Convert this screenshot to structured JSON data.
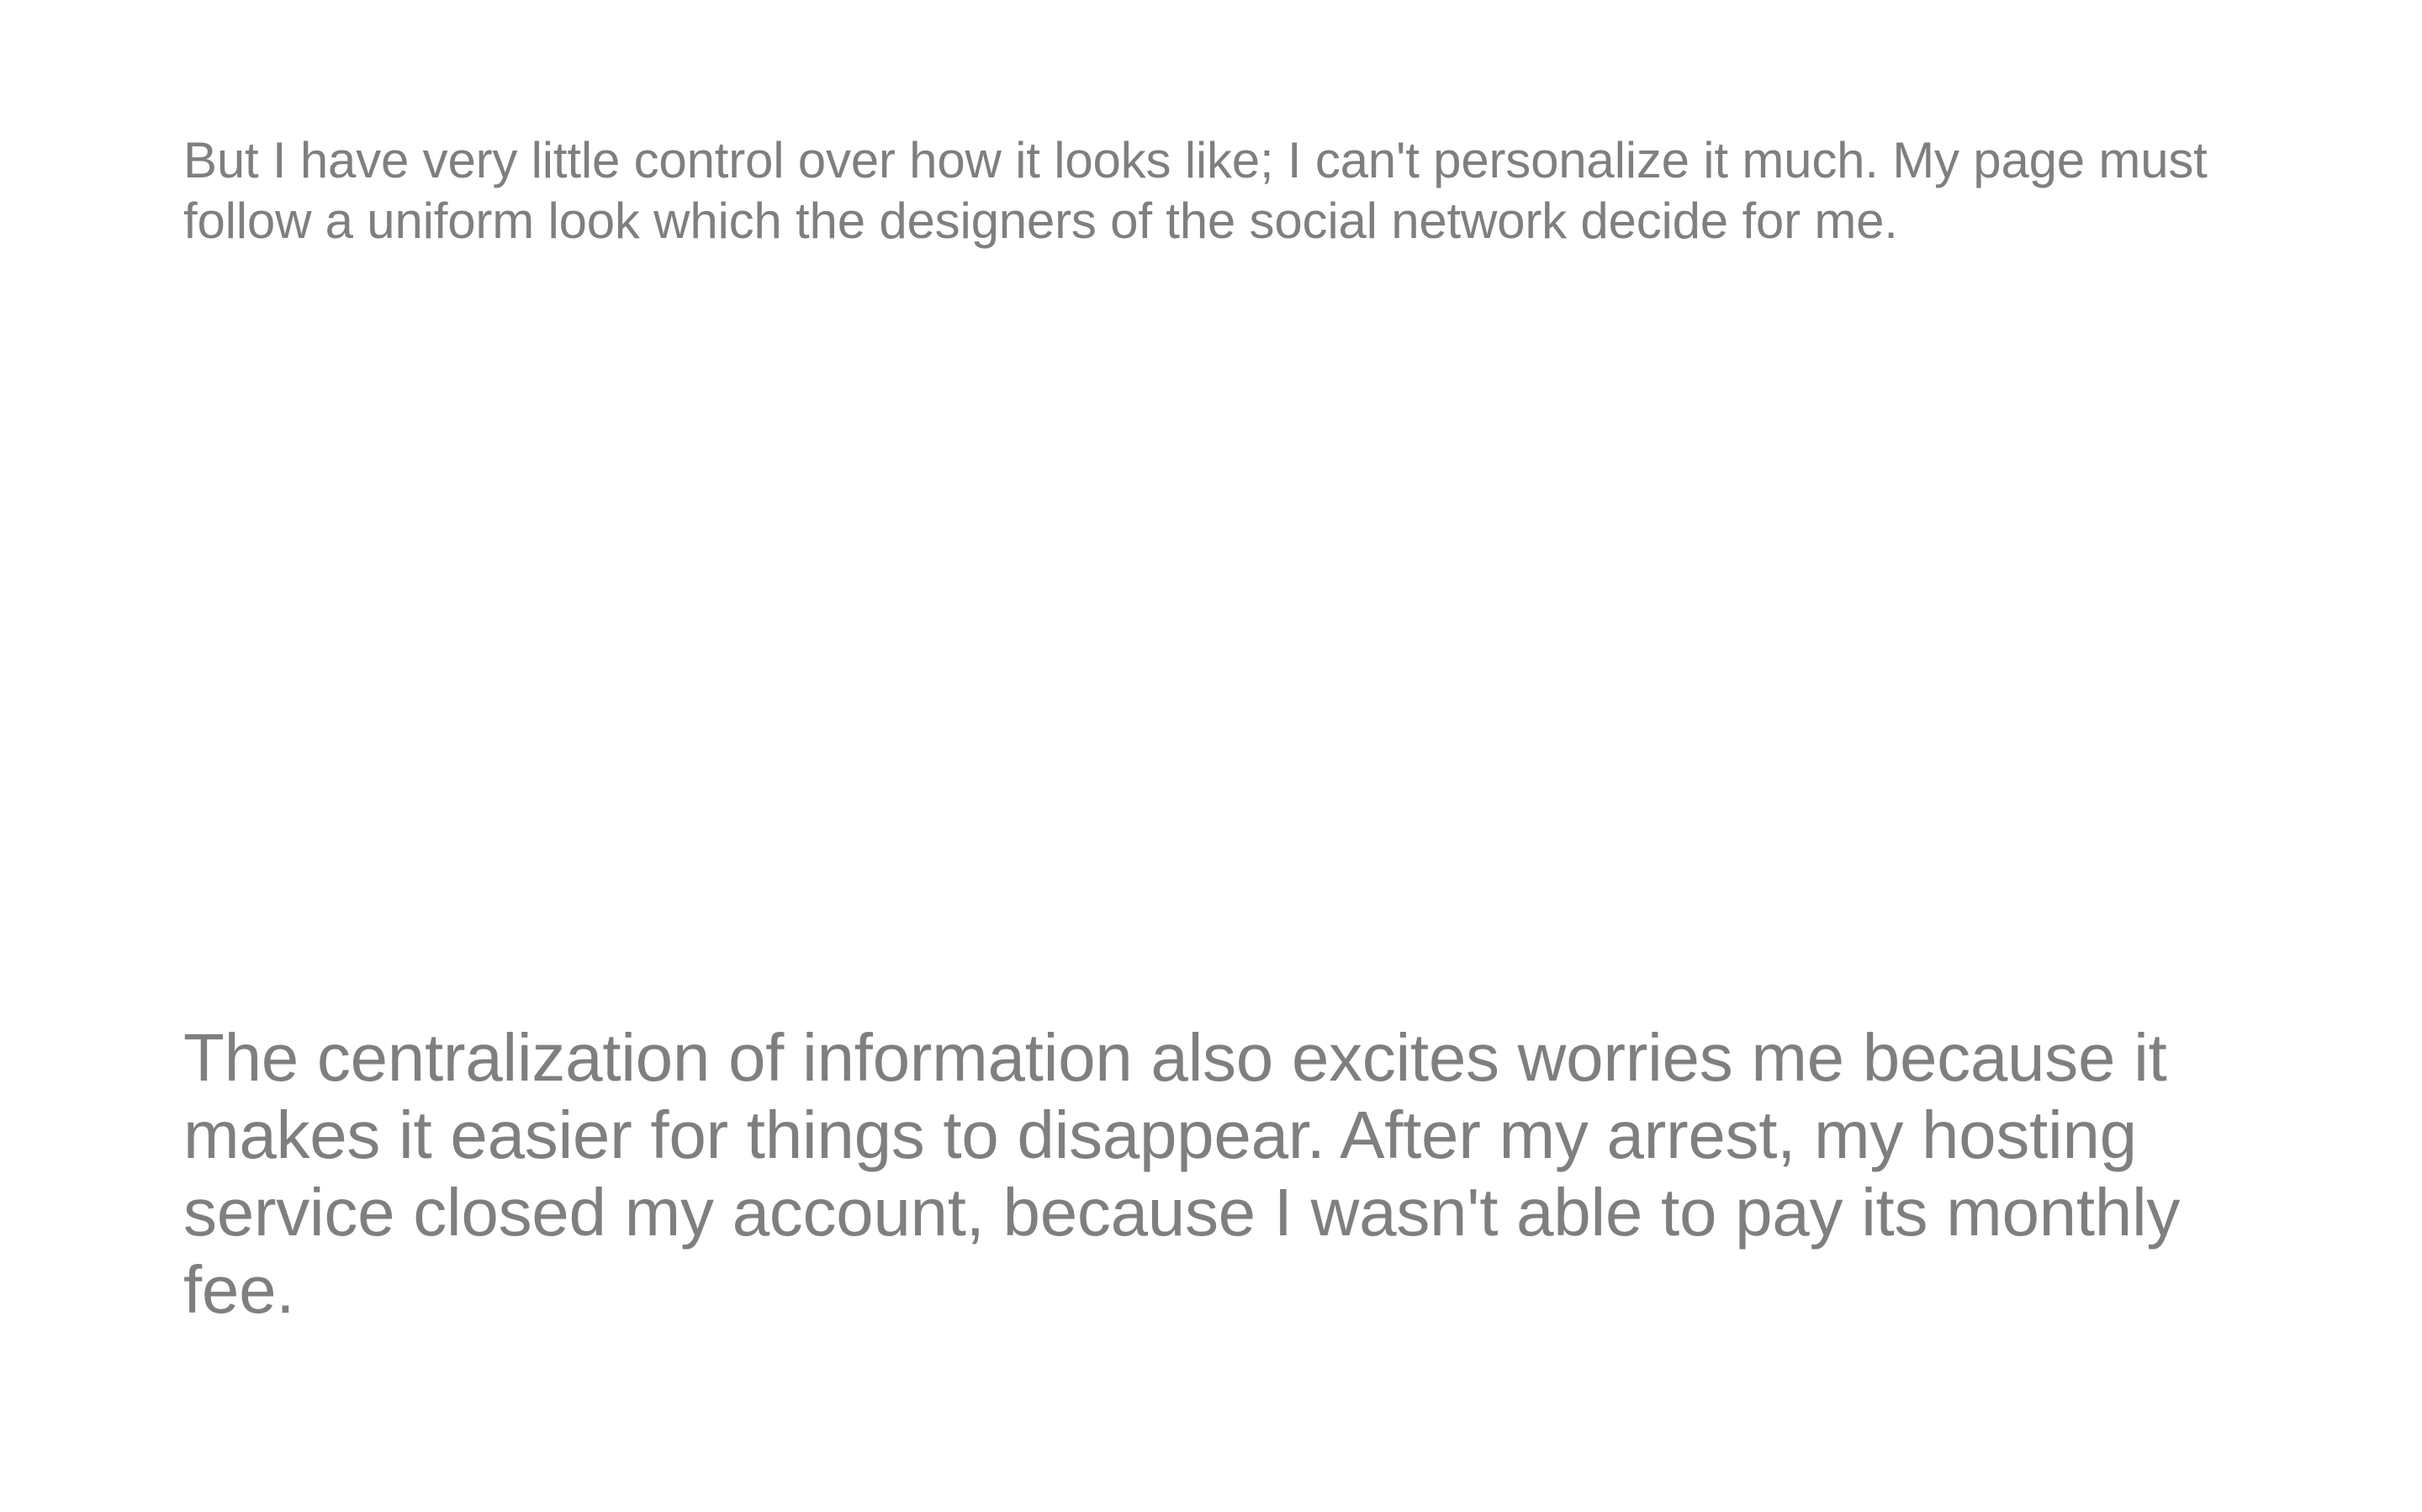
{
  "document": {
    "paragraph_1": "But I have very little control over how it looks like; I can't personalize it much. My page must follow a uniform look which the designers of the social network decide for me.",
    "paragraph_2": "The centralization of information also excites worries me because it makes it easier for things to disappear. After my arrest, my hosting service closed my account, because I wasn't able to pay its monthly fee."
  },
  "colors": {
    "text": "#7f7f7f",
    "background": "#ffffff"
  }
}
